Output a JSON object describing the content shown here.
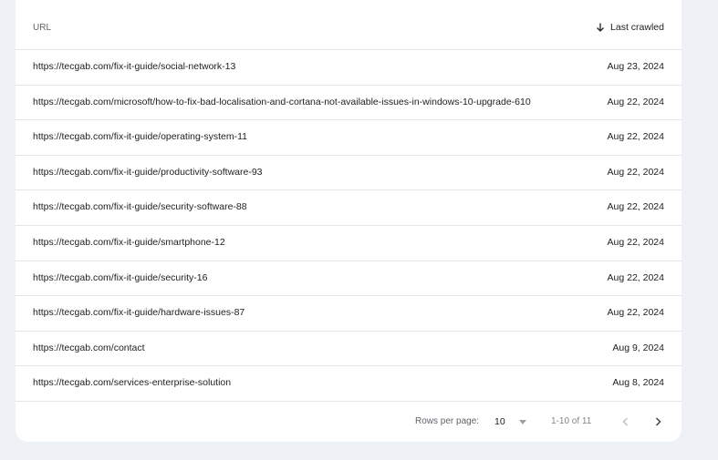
{
  "table": {
    "headers": {
      "url": "URL",
      "last_crawled": "Last crawled"
    },
    "sort_icon": "arrow-down-icon",
    "rows": [
      {
        "url": "https://tecgab.com/fix-it-guide/social-network-13",
        "date": "Aug 23, 2024"
      },
      {
        "url": "https://tecgab.com/microsoft/how-to-fix-bad-localisation-and-cortana-not-available-issues-in-windows-10-upgrade-610",
        "date": "Aug 22, 2024"
      },
      {
        "url": "https://tecgab.com/fix-it-guide/operating-system-11",
        "date": "Aug 22, 2024"
      },
      {
        "url": "https://tecgab.com/fix-it-guide/productivity-software-93",
        "date": "Aug 22, 2024"
      },
      {
        "url": "https://tecgab.com/fix-it-guide/security-software-88",
        "date": "Aug 22, 2024"
      },
      {
        "url": "https://tecgab.com/fix-it-guide/smartphone-12",
        "date": "Aug 22, 2024"
      },
      {
        "url": "https://tecgab.com/fix-it-guide/security-16",
        "date": "Aug 22, 2024"
      },
      {
        "url": "https://tecgab.com/fix-it-guide/hardware-issues-87",
        "date": "Aug 22, 2024"
      },
      {
        "url": "https://tecgab.com/contact",
        "date": "Aug 9, 2024"
      },
      {
        "url": "https://tecgab.com/services-enterprise-solution",
        "date": "Aug 8, 2024"
      }
    ]
  },
  "pagination": {
    "rows_per_page_label": "Rows per page:",
    "rows_per_page_value": "10",
    "range_text": "1-10 of 11",
    "prev_icon": "chevron-left-icon",
    "next_icon": "chevron-right-icon"
  },
  "colors": {
    "background": "#eef1f6",
    "card": "#ffffff",
    "divider": "#e3e6ea",
    "text": "#202124",
    "muted": "#5f6368"
  }
}
